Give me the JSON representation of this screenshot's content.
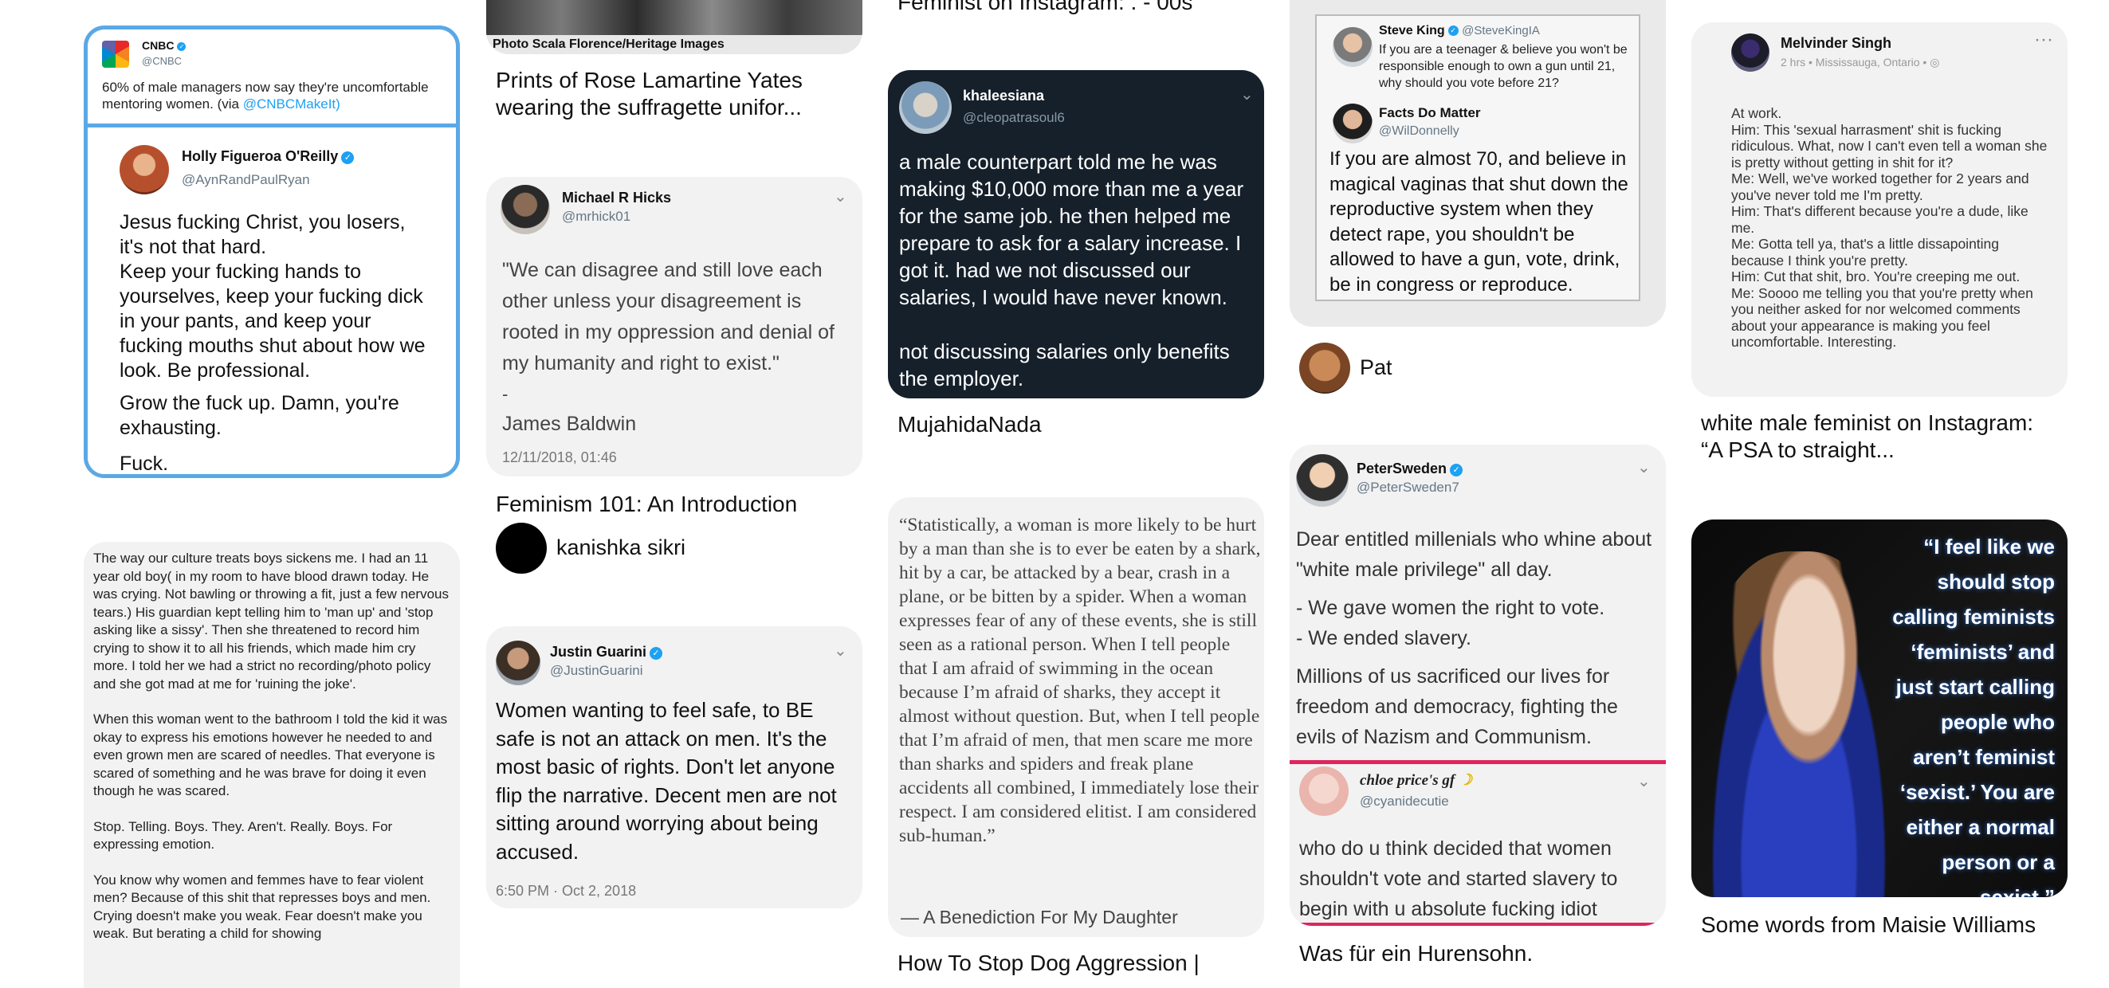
{
  "column1": {
    "pin1": {
      "outer_user": "CNBC",
      "outer_handle": "@CNBC",
      "outer_text": "60% of male managers now say they're uncomfortable mentoring women. (via",
      "outer_link": "@CNBCMakeIt)",
      "inner_user": "Holly Figueroa O'Reilly",
      "inner_handle": "@AynRandPaulRyan",
      "p1": "Jesus fucking Christ, you losers, it's not that hard.",
      "p2": "Keep your fucking hands to yourselves, keep your fucking dick in your pants, and keep your fucking mouths shut about how we look. Be professional.",
      "p3": "Grow the fuck up. Damn, you're exhausting.",
      "p4": "Fuck."
    },
    "pin2": {
      "p1": "The way our culture treats boys sickens me. I had an 11 year old boy( in my room to have blood drawn today. He was crying. Not bawling or throwing a fit, just a few nervous tears.) His guardian kept telling him to 'man up' and 'stop asking like a sissy'. Then she threatened to record him crying to show it to all his friends, which made him cry more. I told her we had a strict no recording/photo policy and she got mad at me for 'ruining the joke'.",
      "p2": "When this woman went to the bathroom I told the kid it was okay to express his emotions however he needed to and even grown men are scared of needles. That everyone is scared of something and he was brave for doing it even though he was scared.",
      "p3": "Stop. Telling. Boys. They. Aren't. Really. Boys. For expressing emotion.",
      "p4": "You know why women and femmes have to fear violent men? Because of this shit that represses boys and men. Crying doesn't make you weak. Fear doesn't make you weak. But berating a child for showing"
    }
  },
  "column2": {
    "pin1": {
      "caption": "Photo Scala Florence/Heritage Images",
      "title": "Prints of Rose Lamartine Yates wearing the suffragette unifor..."
    },
    "pin2": {
      "user": "Michael R Hicks",
      "handle": "@mrhick01",
      "quote": "\"We can disagree and still love each other unless your disagreement is rooted in my oppression and denial of my humanity and right to exist.\"",
      "dash": "-",
      "author": "James Baldwin",
      "date": "12/11/2018, 01:46",
      "title": "Feminism 101: An Introduction",
      "pinner": "kanishka sikri"
    },
    "pin3": {
      "user": "Justin Guarini",
      "handle": "@JustinGuarini",
      "text": "Women wanting to feel safe, to BE safe is not an attack on men. It's the most basic of rights. Don't let anyone flip the narrative. Decent men are not sitting around worrying about being accused.",
      "date": "6:50 PM · Oct 2, 2018"
    }
  },
  "column3": {
    "pin0": {
      "title": "Feminist on Instagram: . - 00s"
    },
    "pin1": {
      "user": "khaleesiana",
      "handle": "@cleopatrasoul6",
      "p1": "a male counterpart told me he was making $10,000 more than me a year for the same job. he then helped me prepare to ask for a salary increase. I got it. had we not discussed our salaries, I would  have never known.",
      "p2": "not discussing salaries only benefits the employer.",
      "title": "MujahidaNada"
    },
    "pin2": {
      "text": "“Statistically, a woman is more likely to be hurt by a man than she is to ever be eaten by a shark, hit by a car, be attacked by a bear, crash in a plane, or be bitten by a spider. When a woman expresses fear of any of these events, she is still seen as a rational person. When I tell people that I am afraid of swimming in the ocean because I’m afraid of sharks, they accept it almost without question. But, when I tell people that I’m afraid of men, that men scare me more than sharks and spiders and freak plane accidents all combined, I immediately lose their respect. I am considered elitist. I am considered sub-human.”",
      "source": "— A Benediction For My Daughter",
      "title": "How To Stop Dog Aggression |"
    }
  },
  "column4": {
    "pin1": {
      "user": "Steve King",
      "handle": "@SteveKingIA",
      "text": "If you are a teenager & believe you won't be responsible enough to own a gun until 21, why should you vote before 21?",
      "reply_user": "Facts Do Matter",
      "reply_handle": "@WilDonnelly",
      "reply_text": "If you are almost 70, and believe in magical vaginas that shut down the reproductive system when they detect rape, you shouldn't be allowed to have a gun, vote, drink, be in congress or reproduce.",
      "pinner": "Pat"
    },
    "pin2": {
      "user": "PeterSweden",
      "handle": "@PeterSweden7",
      "p1": "Dear entitled millenials who whine about \"white male privilege\" all day.",
      "p2": "- We gave women the right to vote.",
      "p3": "- We ended slavery.",
      "p4": "Millions of us sacrificed our lives for freedom and democracy, fighting the evils of Nazism and Communism.",
      "reply_user": "chloe price's gf",
      "reply_handle": "@cyanidecutie",
      "reply_text": "who do u think decided that women shouldn't vote and started slavery to begin with u absolute fucking idiot",
      "title": "Was für ein Hurensohn."
    }
  },
  "column5": {
    "pin1": {
      "user": "Melvinder Singh",
      "meta": "2 hrs • Mississauga, Ontario • ◎",
      "lines": [
        "At work.",
        "Him: This 'sexual harrasment' shit is fucking ridiculous. What,  now I can't even tell a woman she is pretty without getting in shit for it?",
        "Me: Well,  we've worked together for 2 years and you've never told me I'm pretty.",
        "Him: That's different because  you're a dude, like me.",
        "Me: Gotta tell ya, that's a little dissapointing because I think you're pretty.",
        "Him: Cut that shit, bro. You're creeping me out.",
        "Me: Soooo me telling you that you're pretty when you neither asked for nor welcomed comments about your appearance is making you feel uncomfortable. Interesting."
      ],
      "title": "white male feminist on Instagram: “A PSA to straight..."
    },
    "pin2": {
      "quote": "“I feel like we should stop calling feminists ‘feminists’ and just start calling people who aren’t feminist ‘sexist.’ You are either a normal person or a sexist.”",
      "title": "Some words from Maisie Williams"
    }
  },
  "colors": {
    "twitter_blue": "#1da1f2",
    "cnbc_border": "#5aa9e6",
    "dark_card": "#15202b",
    "red_divider": "#e0245e"
  }
}
